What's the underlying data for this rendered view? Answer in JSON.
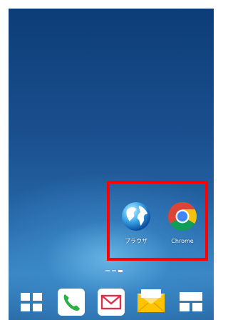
{
  "home_screen": {
    "apps": [
      {
        "label": "ブラウザ",
        "icon": "browser-globe-icon"
      },
      {
        "label": "Chrome",
        "icon": "chrome-icon"
      }
    ],
    "highlight_color": "#ff0000",
    "page_indicator": {
      "pages": 3,
      "current": 3
    },
    "dock": [
      {
        "icon": "app-drawer-icon"
      },
      {
        "icon": "phone-icon"
      },
      {
        "icon": "mail-icon"
      },
      {
        "icon": "email-envelope-icon"
      },
      {
        "icon": "widget-list-icon"
      }
    ]
  }
}
